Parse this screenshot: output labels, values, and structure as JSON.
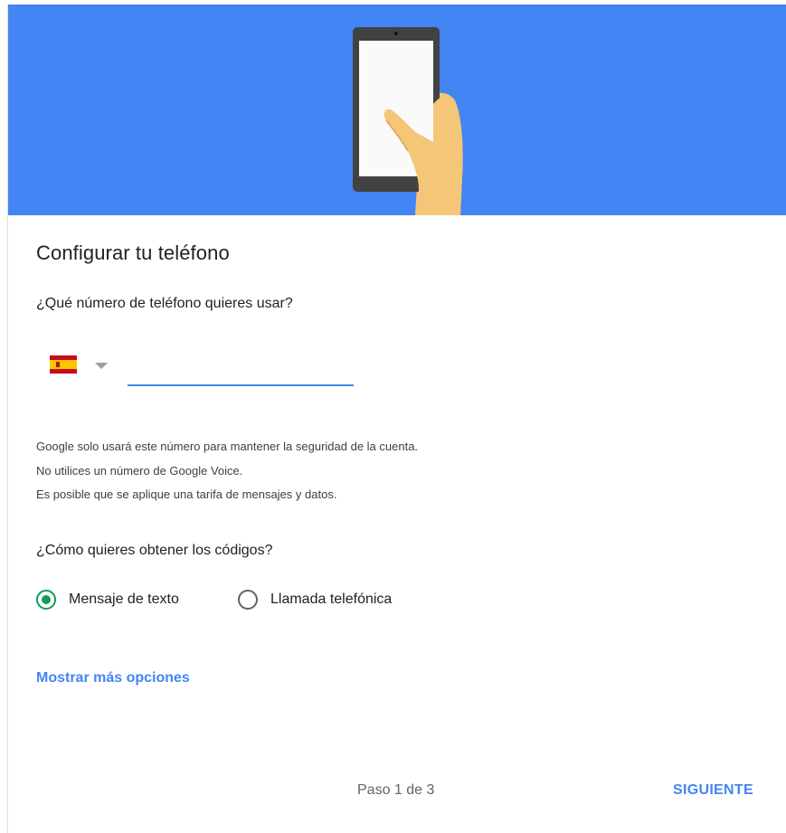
{
  "header": {
    "illustration": "phone-in-hand-illustration",
    "background_color": "#4285f4"
  },
  "title": "Configurar tu teléfono",
  "phone_question": "¿Qué número de teléfono quieres usar?",
  "country_selector": {
    "selected_flag": "spain-flag-icon",
    "arrow": "dropdown-arrow-icon"
  },
  "phone_input": {
    "value": "",
    "placeholder": ""
  },
  "notes": [
    "Google solo usará este número para mantener la seguridad de la cuenta.",
    "No utilices un número de Google Voice.",
    "Es posible que se aplique una tarifa de mensajes y datos."
  ],
  "codes_question": "¿Cómo quieres obtener los códigos?",
  "options": [
    {
      "label": "Mensaje de texto",
      "checked": true
    },
    {
      "label": "Llamada telefónica",
      "checked": false
    }
  ],
  "more_options_link": "Mostrar más opciones",
  "footer": {
    "step": "Paso 1 de 3",
    "next_button": "SIGUIENTE"
  },
  "colors": {
    "accent": "#4285f4",
    "radio_checked": "#0f9d58"
  }
}
